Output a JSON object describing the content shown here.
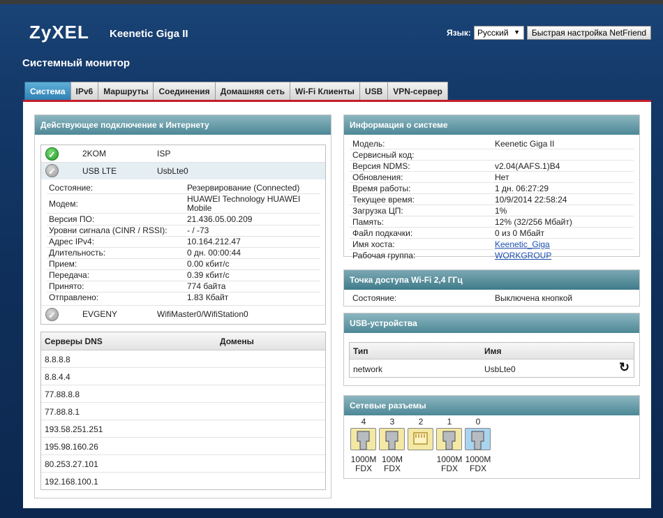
{
  "brand": "ZyXEL",
  "model_title": "Keenetic Giga II",
  "language": {
    "label": "Язык:",
    "selected": "Русский"
  },
  "netfriend_button": "Быстрая настройка NetFriend",
  "page_title": "Системный монитор",
  "tabs": [
    "Система",
    "IPv6",
    "Маршруты",
    "Соединения",
    "Домашняя сеть",
    "Wi-Fi Клиенты",
    "USB",
    "VPN-сервер"
  ],
  "internet": {
    "title": "Действующее подключение к Интернету",
    "connections": [
      {
        "name": "2KOM",
        "iface": "ISP",
        "status": "active"
      },
      {
        "name": "USB LTE",
        "iface": "UsbLte0",
        "status": "standby"
      },
      {
        "name": "EVGENY",
        "iface": "WifiMaster0/WifiStation0",
        "status": "standby"
      }
    ],
    "details": [
      {
        "k": "Состояние:",
        "v": "Резервирование (Connected)"
      },
      {
        "k": "Модем:",
        "v": "HUAWEI Technology HUAWEI",
        "v2": "Mobile"
      },
      {
        "k": "Версия ПО:",
        "v": "21.436.05.00.209"
      },
      {
        "k": "Уровни сигнала (CINR / RSSI):",
        "v": "- / -73"
      },
      {
        "k": "Адрес IPv4:",
        "v": "10.164.212.47"
      },
      {
        "k": "Длительность:",
        "v": "0 дн. 00:00:44"
      },
      {
        "k": "Прием:",
        "v": "0.00 кбит/с"
      },
      {
        "k": "Передача:",
        "v": "0.39 кбит/с"
      },
      {
        "k": "Принято:",
        "v": "774 байта"
      },
      {
        "k": "Отправлено:",
        "v": "1.83 Кбайт"
      }
    ]
  },
  "dns": {
    "col_servers": "Серверы DNS",
    "col_domains": "Домены",
    "servers": [
      "8.8.8.8",
      "8.8.4.4",
      "77.88.8.8",
      "77.88.8.1",
      "193.58.251.251",
      "195.98.160.26",
      "80.253.27.101",
      "192.168.100.1"
    ]
  },
  "sysinfo": {
    "title": "Информация о системе",
    "rows": [
      {
        "k": "Модель:",
        "v": "Keenetic Giga II"
      },
      {
        "k": "Сервисный код:",
        "v": ""
      },
      {
        "k": "Версия NDMS:",
        "v": "v2.04(AAFS.1)B4"
      },
      {
        "k": "Обновления:",
        "v": "Нет"
      },
      {
        "k": "Время работы:",
        "v": "1 дн. 06:27:29"
      },
      {
        "k": "Текущее время:",
        "v": "10/9/2014 22:58:24"
      },
      {
        "k": "Загрузка ЦП:",
        "v": "1%"
      },
      {
        "k": "Память:",
        "v": "12% (32/256 Мбайт)"
      },
      {
        "k": "Файл подкачки:",
        "v": "0 из 0 Мбайт"
      },
      {
        "k": "Имя хоста:",
        "v": "Keenetic_Giga",
        "link": true
      },
      {
        "k": "Рабочая группа:",
        "v": "WORKGROUP",
        "link": true
      }
    ]
  },
  "wifi": {
    "title": "Точка доступа Wi-Fi 2,4 ГГц",
    "k": "Состояние:",
    "v": "Выключена кнопкой"
  },
  "usb": {
    "title": "USB-устройства",
    "col_type": "Тип",
    "col_name": "Имя",
    "rows": [
      {
        "type": "network",
        "name": "UsbLte0"
      }
    ]
  },
  "ports": {
    "title": "Сетевые разъемы",
    "items": [
      {
        "num": "4",
        "speed": "1000M",
        "duplex": "FDX",
        "color": "yellow",
        "kind": "plug"
      },
      {
        "num": "3",
        "speed": "100M",
        "duplex": "FDX",
        "color": "yellow",
        "kind": "plug"
      },
      {
        "num": "2",
        "speed": "",
        "duplex": "",
        "color": "yellow",
        "kind": "empty"
      },
      {
        "num": "1",
        "speed": "1000M",
        "duplex": "FDX",
        "color": "yellow",
        "kind": "plug"
      },
      {
        "num": "0",
        "speed": "1000M",
        "duplex": "FDX",
        "color": "blue",
        "kind": "plug"
      }
    ]
  }
}
